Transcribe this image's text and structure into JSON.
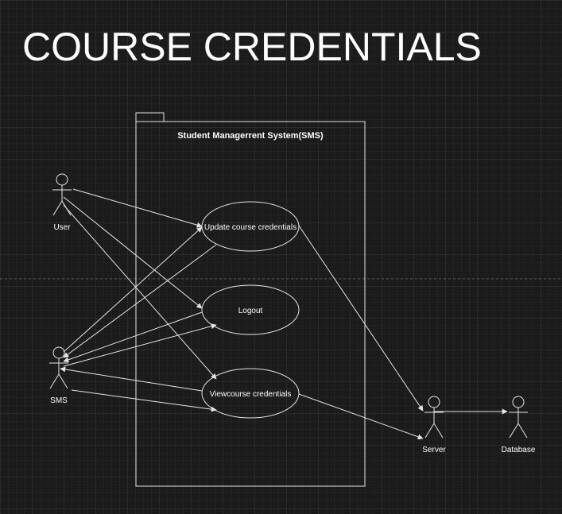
{
  "title": "COURSE CREDENTIALS",
  "system": {
    "label": "Student Managerrent System(SMS)"
  },
  "use_cases": {
    "update": "Update course credentials",
    "logout": "Logout",
    "view": "Viewcourse credentials"
  },
  "actors": {
    "user": "User",
    "sms": "SMS",
    "server": "Server",
    "database": "Database"
  },
  "colors": {
    "background": "#1b1b1b",
    "stroke": "#e6e6e6",
    "system_fill": "#141414",
    "text": "#ffffff"
  }
}
